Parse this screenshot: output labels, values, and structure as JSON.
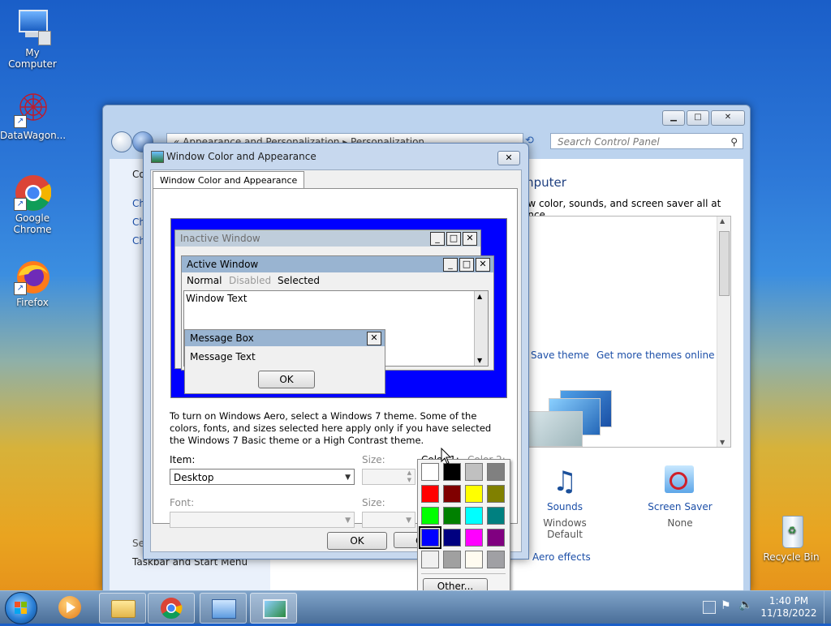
{
  "desktop": {
    "icons": [
      {
        "label": "My Computer"
      },
      {
        "label": "DataWagon..."
      },
      {
        "label": "Google Chrome"
      },
      {
        "label": "Firefox"
      },
      {
        "label": "Recycle Bin"
      }
    ]
  },
  "control_panel": {
    "address": "« Appearance and Personalization ▸ Personalization",
    "search_placeholder": "Search Control Panel",
    "left_items": [
      "Co",
      "Ch",
      "Ch",
      "Ch",
      "Se",
      "Taskbar and Start Menu"
    ],
    "heading": "mputer",
    "subtext": "ow color, sounds, and screen saver all at once.",
    "save_theme": "Save theme",
    "get_more_themes": "Get more themes online",
    "sounds_label": "Sounds",
    "sounds_value": "Windows Default",
    "screensaver_label": "Screen Saver",
    "screensaver_value": "None",
    "aero_effects": "Aero effects"
  },
  "dialog": {
    "title": "Window Color and Appearance",
    "tab_label": "Window Color and Appearance",
    "preview": {
      "inactive_title": "Inactive Window",
      "active_title": "Active Window",
      "menu_normal": "Normal",
      "menu_disabled": "Disabled",
      "menu_selected": "Selected",
      "window_text": "Window Text",
      "msgbox_title": "Message Box",
      "msgbox_text": "Message Text",
      "msgbox_ok": "OK"
    },
    "info_text": "To turn on Windows Aero, select a Windows 7 theme.  Some of the colors, fonts, and sizes selected here apply only if you have selected the Windows 7 Basic theme or a High Contrast theme.",
    "item_label": "Item:",
    "item_value": "Desktop",
    "size_label": "Size:",
    "color1_label": "Color 1:",
    "color2_label": "Color 2:",
    "font_label": "Font:",
    "size2_label": "Size:",
    "ok_label": "OK",
    "cancel_label": "Ca"
  },
  "color_picker": {
    "selected_color": "#0000ff",
    "swatches": [
      "#ffffff",
      "#000000",
      "#c0c0c0",
      "#808080",
      "#ff0000",
      "#800000",
      "#ffff00",
      "#808000",
      "#00ff00",
      "#008000",
      "#00ffff",
      "#008080",
      "#0000ff",
      "#000080",
      "#ff00ff",
      "#800080",
      "#f0f0f0",
      "#a0a0a0",
      "#fffbf0",
      "#a0a0a4"
    ],
    "other_label": "Other..."
  },
  "taskbar": {
    "time": "1:40 PM",
    "date": "11/18/2022"
  }
}
